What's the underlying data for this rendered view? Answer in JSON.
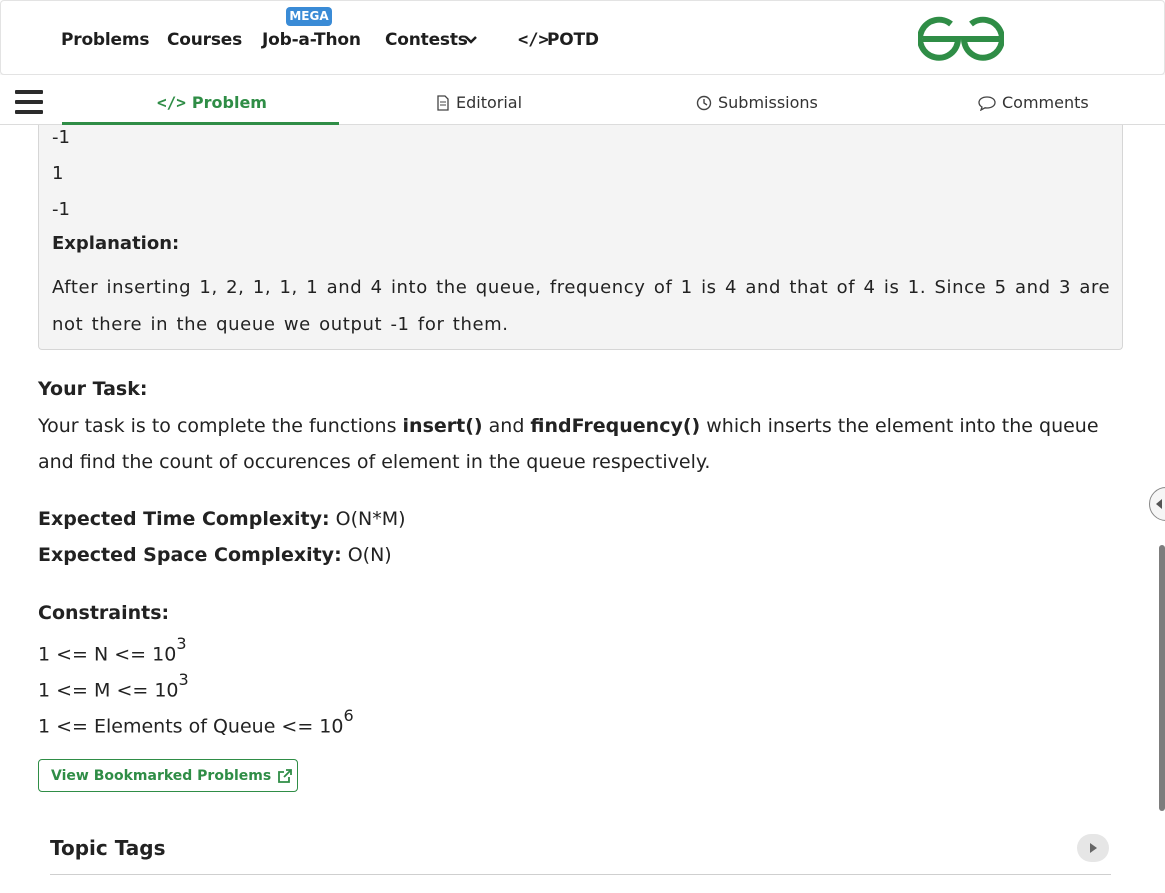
{
  "topnav": {
    "items": [
      "Problems",
      "Courses",
      "Job-a-Thon",
      "Contests",
      "POTD"
    ],
    "mega_badge": "MEGA",
    "potd_icon": "</>",
    "logo": "geeksforgeeks-logo",
    "brand_color": "#2f8d46"
  },
  "tabs": {
    "problem": "Problem",
    "editorial": "Editorial",
    "submissions": "Submissions",
    "comments": "Comments",
    "active": "Problem"
  },
  "example": {
    "output_lines": [
      "-1",
      "1",
      "-1"
    ],
    "explanation_label": "Explanation:",
    "explanation_text": "After inserting 1, 2, 1, 1, 1 and 4 into the queue, frequency of 1 is 4 and that of 4 is 1. Since 5 and 3 are not there in the queue we output -1 for them."
  },
  "task": {
    "heading": "Your Task:",
    "text_1": "Your task is to complete the functions ",
    "fn1": "insert()",
    "text_2": " and ",
    "fn2": "findFrequency()",
    "text_3": " which inserts the element into the queue and find the count of occurences of element in the queue respectively."
  },
  "complexity": {
    "time_label": "Expected Time Complexity:",
    "time_value": " O(N*M)",
    "space_label": "Expected Space Complexity:",
    "space_value": " O(N)"
  },
  "constraints": {
    "heading": "Constraints:",
    "lines": [
      {
        "text": "1 <= N <= 10",
        "sup": "3"
      },
      {
        "text": "1 <= M <= 10",
        "sup": "3"
      },
      {
        "text": "1 <= Elements of Queue <= 10",
        "sup": "6"
      }
    ]
  },
  "bookmark_button": "View Bookmarked Problems",
  "topic_tags": "Topic Tags"
}
